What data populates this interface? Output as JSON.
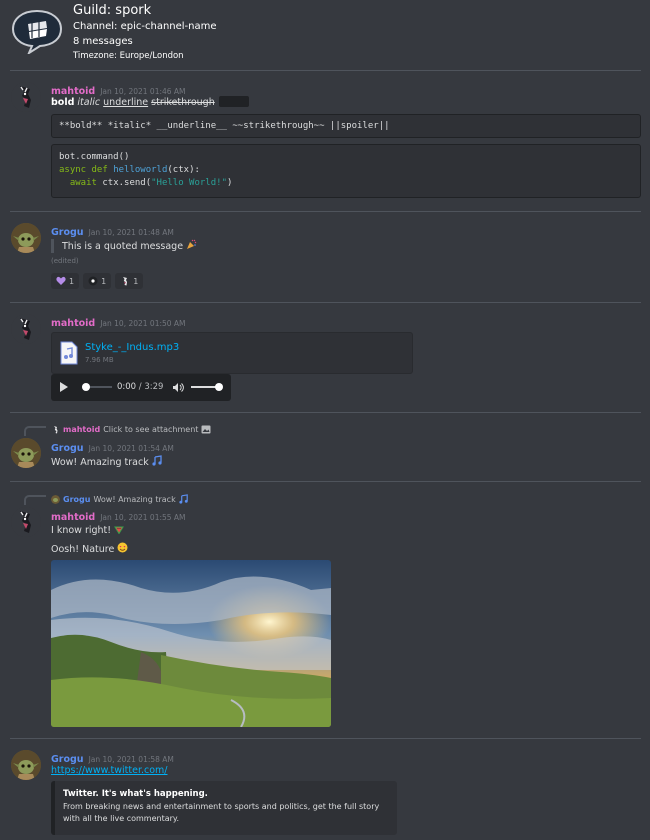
{
  "guild": {
    "name": "Guild: spork",
    "channel": "Channel: epic-channel-name",
    "count": "8 messages",
    "timezone": "Timezone: Europe/London"
  },
  "colors": {
    "background": "#36393f",
    "mahtoid": "#e26cc8",
    "grogu": "#5b8ef0",
    "link": "#00b0f4"
  },
  "messages": {
    "m1": {
      "author": "mahtoid",
      "time": "Jan 10, 2021 01:46 AM",
      "bold": "bold",
      "italic": "italic",
      "underline": "underline",
      "strike": "strikethrough",
      "code_inline": "**bold** *italic* __underline__ ~~strikethrough~~ ||spoiler||",
      "code_l1": "bot.command()",
      "code_kw1": "async",
      "code_kw2": "def",
      "code_fn": "helloworld",
      "code_args": "(ctx):",
      "code_kw3": "await",
      "code_call": " ctx.send(",
      "code_str": "\"Hello World!\"",
      "code_end": ")"
    },
    "m2": {
      "author": "Grogu",
      "time": "Jan 10, 2021 01:48 AM",
      "quote": "This is a quoted message",
      "quote_emoji": "party-popper-emoji",
      "edited": "(edited)",
      "reactions": [
        {
          "icon": "purple-heart-icon",
          "count": "1"
        },
        {
          "icon": "dot-emoji-icon",
          "count": "1"
        },
        {
          "icon": "avatar-emoji-icon",
          "count": "1"
        }
      ]
    },
    "m3": {
      "author": "mahtoid",
      "time": "Jan 10, 2021 01:50 AM",
      "file_name": "Styke_-_Indus.mp3",
      "file_size": "7.96 MB",
      "time_current": "0:00",
      "time_total": " / 3:29"
    },
    "m4": {
      "reply_author": "mahtoid",
      "reply_text": "Click to see attachment",
      "author": "Grogu",
      "time": "Jan 10, 2021 01:54 AM",
      "text": "Wow! Amazing track"
    },
    "m5": {
      "reply_author": "Grogu",
      "reply_text": "Wow! Amazing track",
      "author": "mahtoid",
      "time": "Jan 10, 2021 01:55 AM",
      "text1": "I know right!",
      "text2": "Oosh! Nature"
    },
    "m6": {
      "author": "Grogu",
      "time": "Jan 10, 2021 01:58 AM",
      "link": "https://www.twitter.com/",
      "embed_title": "Twitter. It's what's happening.",
      "embed_desc": "From breaking news and entertainment to sports and politics, get the full story with all the live commentary."
    }
  }
}
